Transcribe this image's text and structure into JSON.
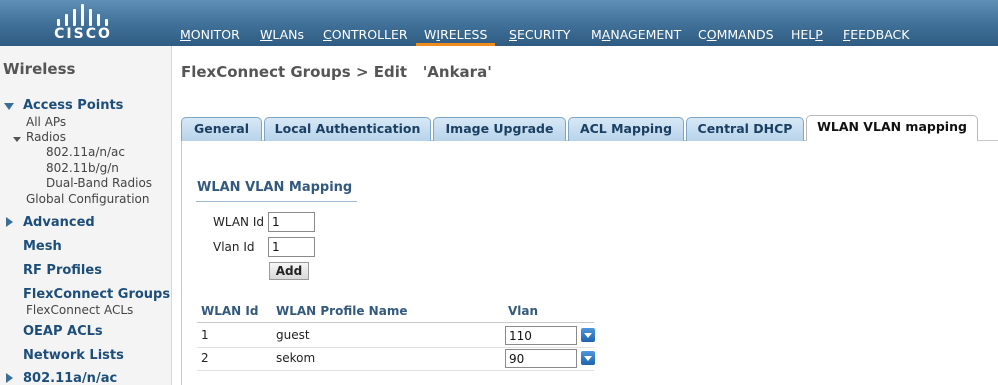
{
  "brand": {
    "name": "CISCO"
  },
  "menu": [
    {
      "key": "M",
      "rest": "ONITOR"
    },
    {
      "key": "W",
      "rest": "LANs"
    },
    {
      "key": "C",
      "rest": "ONTROLLER"
    },
    {
      "key": "I",
      "rest": "RELESS",
      "pre": "W"
    },
    {
      "key": "S",
      "rest": "ECURITY"
    },
    {
      "key": "A",
      "rest": "NAGEMENT",
      "pre": "M"
    },
    {
      "key": "O",
      "rest": "MMANDS",
      "pre": "C"
    },
    {
      "key": "P",
      "rest": "",
      "pre": "HEL"
    },
    {
      "key": "F",
      "rest": "EEDBACK"
    }
  ],
  "menu_active": "WIRELESS",
  "sidebar": {
    "title": "Wireless",
    "access_points": "Access Points",
    "all_aps": "All APs",
    "radios": "Radios",
    "radio_1": "802.11a/n/ac",
    "radio_2": "802.11b/g/n",
    "radio_3": "Dual-Band Radios",
    "global_config": "Global Configuration",
    "advanced": "Advanced",
    "mesh": "Mesh",
    "rf_profiles": "RF Profiles",
    "flexconnect_groups": "FlexConnect Groups",
    "flexconnect_acls": "FlexConnect ACLs",
    "oeap_acls": "OEAP ACLs",
    "network_lists": "Network Lists",
    "band_80211anac": "802.11a/n/ac"
  },
  "page": {
    "title": "FlexConnect Groups > Edit   'Ankara'"
  },
  "tabs": [
    "General",
    "Local Authentication",
    "Image Upgrade",
    "ACL Mapping",
    "Central DHCP",
    "WLAN VLAN mapping"
  ],
  "active_tab": "WLAN VLAN mapping",
  "mapping": {
    "section_title": "WLAN VLAN Mapping",
    "wlan_id_label": "WLAN Id",
    "wlan_id_value": "1",
    "vlan_id_label": "Vlan Id",
    "vlan_id_value": "1",
    "add_label": "Add"
  },
  "table": {
    "headers": [
      "WLAN Id",
      "WLAN Profile Name",
      "Vlan"
    ],
    "rows": [
      {
        "wlan_id": "1",
        "profile": "guest",
        "vlan": "110"
      },
      {
        "wlan_id": "2",
        "profile": "sekom",
        "vlan": "90"
      }
    ]
  },
  "colors": {
    "header_blue": "#3f6f97",
    "active_underline": "#f08c1e",
    "link_blue": "#1d4e7a",
    "dropdown_blue": "#1f63ad"
  }
}
